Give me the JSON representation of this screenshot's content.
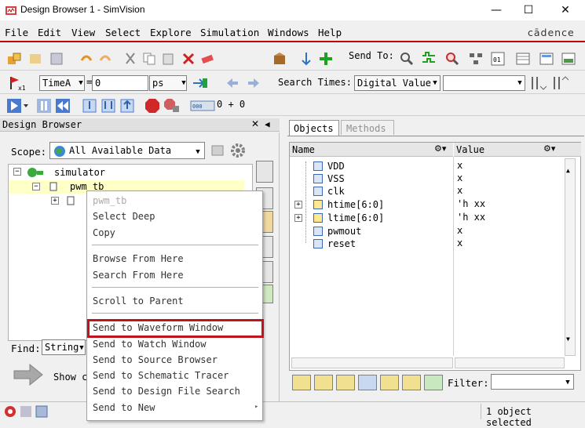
{
  "window": {
    "title": "Design Browser 1 - SimVision",
    "min": "—",
    "max": "☐",
    "close": "✕"
  },
  "brand": "cādence",
  "menu": [
    "File",
    "Edit",
    "View",
    "Select",
    "Explore",
    "Simulation",
    "Windows",
    "Help"
  ],
  "toolbar1": {
    "send_to": "Send To:"
  },
  "toolbar2": {
    "time_unit_label": "TimeA",
    "time_value": "0",
    "unit": "ps",
    "search_times_label": "Search Times:",
    "search_mode": "Digital Value",
    "search_value": ""
  },
  "toolbar3": {
    "time_readout": "0 + 0"
  },
  "design_browser": {
    "header": "Design Browser",
    "scope_label": "Scope:",
    "scope_value": "All Available Data",
    "tree": [
      {
        "label": "simulator"
      },
      {
        "label": "pwm_tb"
      }
    ],
    "find_label": "Find:",
    "find_mode": "String",
    "show_label": "Show c"
  },
  "context_menu": {
    "title": "pwm_tb",
    "items": [
      "Select Deep",
      "Copy",
      "Browse From Here",
      "Search From Here",
      "Scroll to Parent",
      "Send to Waveform Window",
      "Send to Watch Window",
      "Send to Source Browser",
      "Send to Schematic Tracer",
      "Send to Design File Search",
      "Send to New"
    ],
    "highlighted": "Send to Waveform Window",
    "submenu_arrow": "▸"
  },
  "objects_panel": {
    "tabs": [
      "Objects",
      "Methods"
    ],
    "columns": [
      "Name",
      "Value"
    ],
    "rows": [
      {
        "name": "VDD",
        "value": "x"
      },
      {
        "name": "VSS",
        "value": "x"
      },
      {
        "name": "clk",
        "value": "x"
      },
      {
        "name": "htime[6:0]",
        "value": "'h xx"
      },
      {
        "name": "ltime[6:0]",
        "value": "'h xx"
      },
      {
        "name": "pwmout",
        "value": "x"
      },
      {
        "name": "reset",
        "value": "x"
      }
    ],
    "filter_label": "Filter:",
    "filter_value": ""
  },
  "status": {
    "selection": "1 object selected"
  },
  "colors": {
    "accent_red": "#c00000",
    "tree_highlight": "#ffffc8",
    "ctx_highlight_border": "#c0141c"
  }
}
